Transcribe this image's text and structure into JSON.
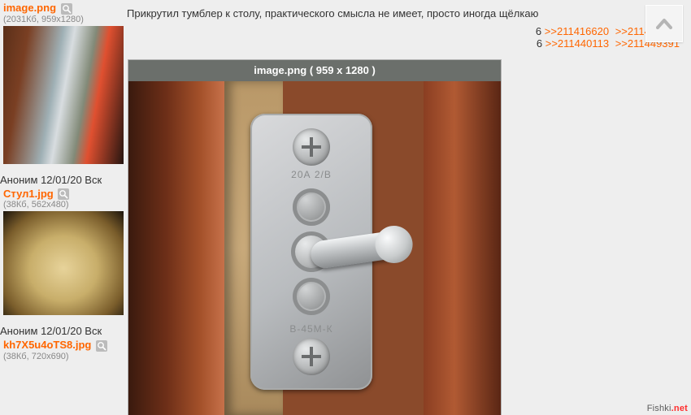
{
  "posts": [
    {
      "file": {
        "name": "image.png",
        "meta": "(2031Кб, 959x1280)"
      }
    },
    {
      "head": "Аноним 12/01/20 Вск",
      "file": {
        "name": "Стул1.jpg",
        "meta": "(38Кб, 562x480)"
      }
    },
    {
      "head": "Аноним 12/01/20 Вск",
      "file": {
        "name": "kh7X5u4oTS8.jpg",
        "meta": "(38Кб, 720x690)"
      }
    }
  ],
  "main": {
    "text": "Прикрутил тумблер к столу, практического смысла не имеет, просто иногда щёлкаю",
    "replies_tail": [
      ">>211416620",
      ">>211417269",
      ">>211440113",
      ">>211449391"
    ],
    "reply_prefix_digit": "6"
  },
  "viewer": {
    "title": "image.png ( 959 x 1280 )",
    "plate_top_text": "20А 2/В",
    "plate_bottom_text": "В-45М-К"
  },
  "watermark": {
    "a": "Fishki",
    "b": ".net"
  }
}
